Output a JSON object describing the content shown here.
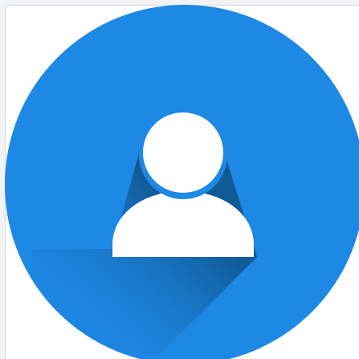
{
  "avatar": {
    "icon": "user-profile-icon",
    "colors": {
      "circle": "#1e88e5",
      "shadow_dark": "#0b4a7a",
      "shadow_light": "#1e88e5",
      "figure": "#ffffff",
      "frame_border": "#d9dcdf",
      "page_bg": "#f1f3f4"
    }
  }
}
